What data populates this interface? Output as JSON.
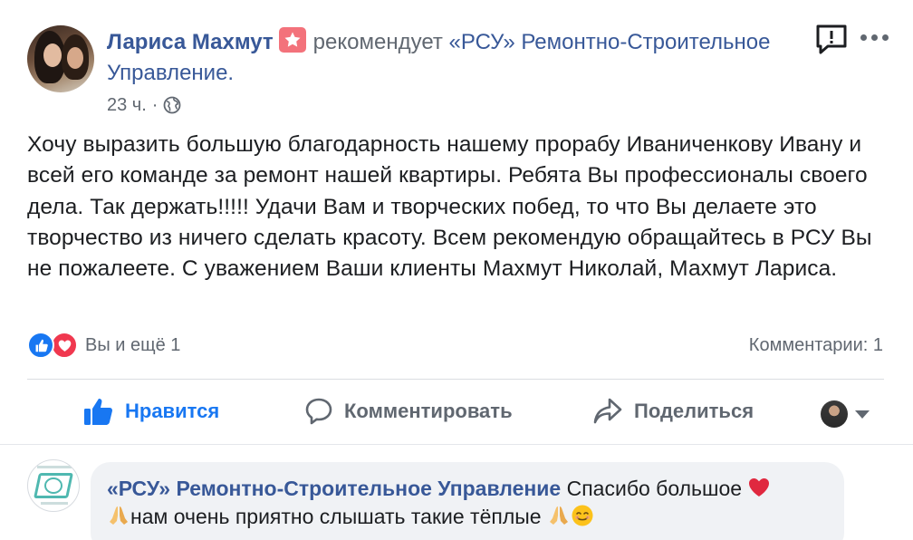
{
  "post": {
    "author": "Лариса Махмут",
    "verb": "рекомендует",
    "page": "«РСУ» Ремонтно-Строительное Управление.",
    "time": "23 ч.",
    "separator": "·",
    "text": "Хочу выразить большую благодарность нашему прорабу Иваниченкову Ивану и всей его команде за ремонт нашей квартиры. Ребята Вы профессионалы своего дела. Так держать!!!!! Удачи Вам и творческих побед, то что Вы делаете это творчество из ничего сделать красоту. Всем рекомендую обращайтесь в РСУ Вы не пожалеете. С уважением Ваши клиенты Махмут Николай, Махмут Лариса."
  },
  "reactions": {
    "summary": "Вы и ещё 1",
    "comments": "Комментарии: 1"
  },
  "actions": {
    "like": "Нравится",
    "comment": "Комментировать",
    "share": "Поделиться"
  },
  "comment": {
    "author": "«РСУ» Ремонтно-Строительное Управление",
    "text_part1": "Спасибо большое",
    "text_part2": "нам очень приятно слышать такие тёплые"
  },
  "colors": {
    "link": "#385898",
    "like_active": "#1877f2",
    "muted": "#606770",
    "badge": "#f3727b"
  },
  "icons": [
    "star-badge-icon",
    "globe-icon",
    "report-icon",
    "more-icon",
    "like-reaction-icon",
    "love-reaction-icon",
    "thumbs-up-icon",
    "comment-icon",
    "share-icon",
    "caret-down-icon",
    "heart-emoji",
    "pray-emoji",
    "smile-emoji"
  ]
}
